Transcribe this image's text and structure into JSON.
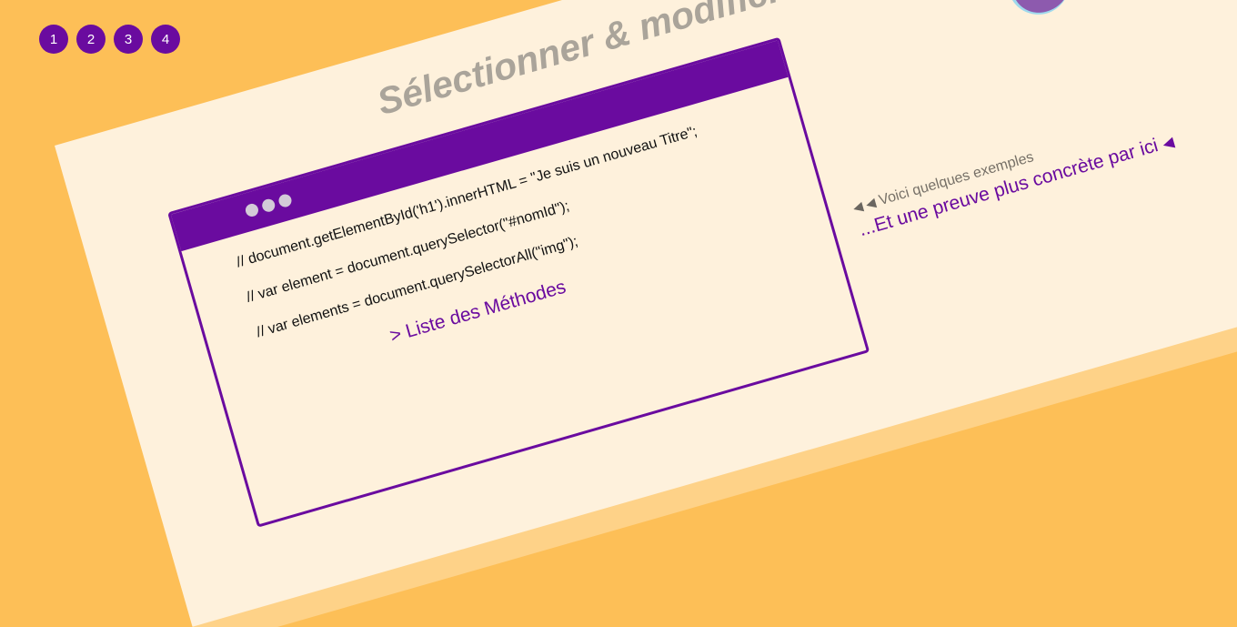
{
  "nav": {
    "steps": [
      "1",
      "2",
      "3",
      "4"
    ]
  },
  "slide": {
    "title": "Sélectionner & modifier des éléments",
    "flask_icon": "potion-flask-icon",
    "code_window": {
      "dots_icon": "three-dots-icon",
      "lines": [
        "// document.getElementById('h1').innerHTML = \"Je suis un nouveau Titre\";",
        "// var element = document.querySelector(\"#nomId\");",
        "// var elements = document.querySelectorAll(\"img\");"
      ],
      "link": "> Liste des Méthodes"
    },
    "notes": {
      "small_arrows": "◀ ◀",
      "small_text": "Voici quelques exemples",
      "link_text": "...Et une preuve plus concrète par ici",
      "link_arrow": "◀"
    }
  },
  "colors": {
    "background": "#fdbf57",
    "slide": "#fef1dc",
    "accent": "#6a0b9f",
    "title": "#aaa49a"
  }
}
